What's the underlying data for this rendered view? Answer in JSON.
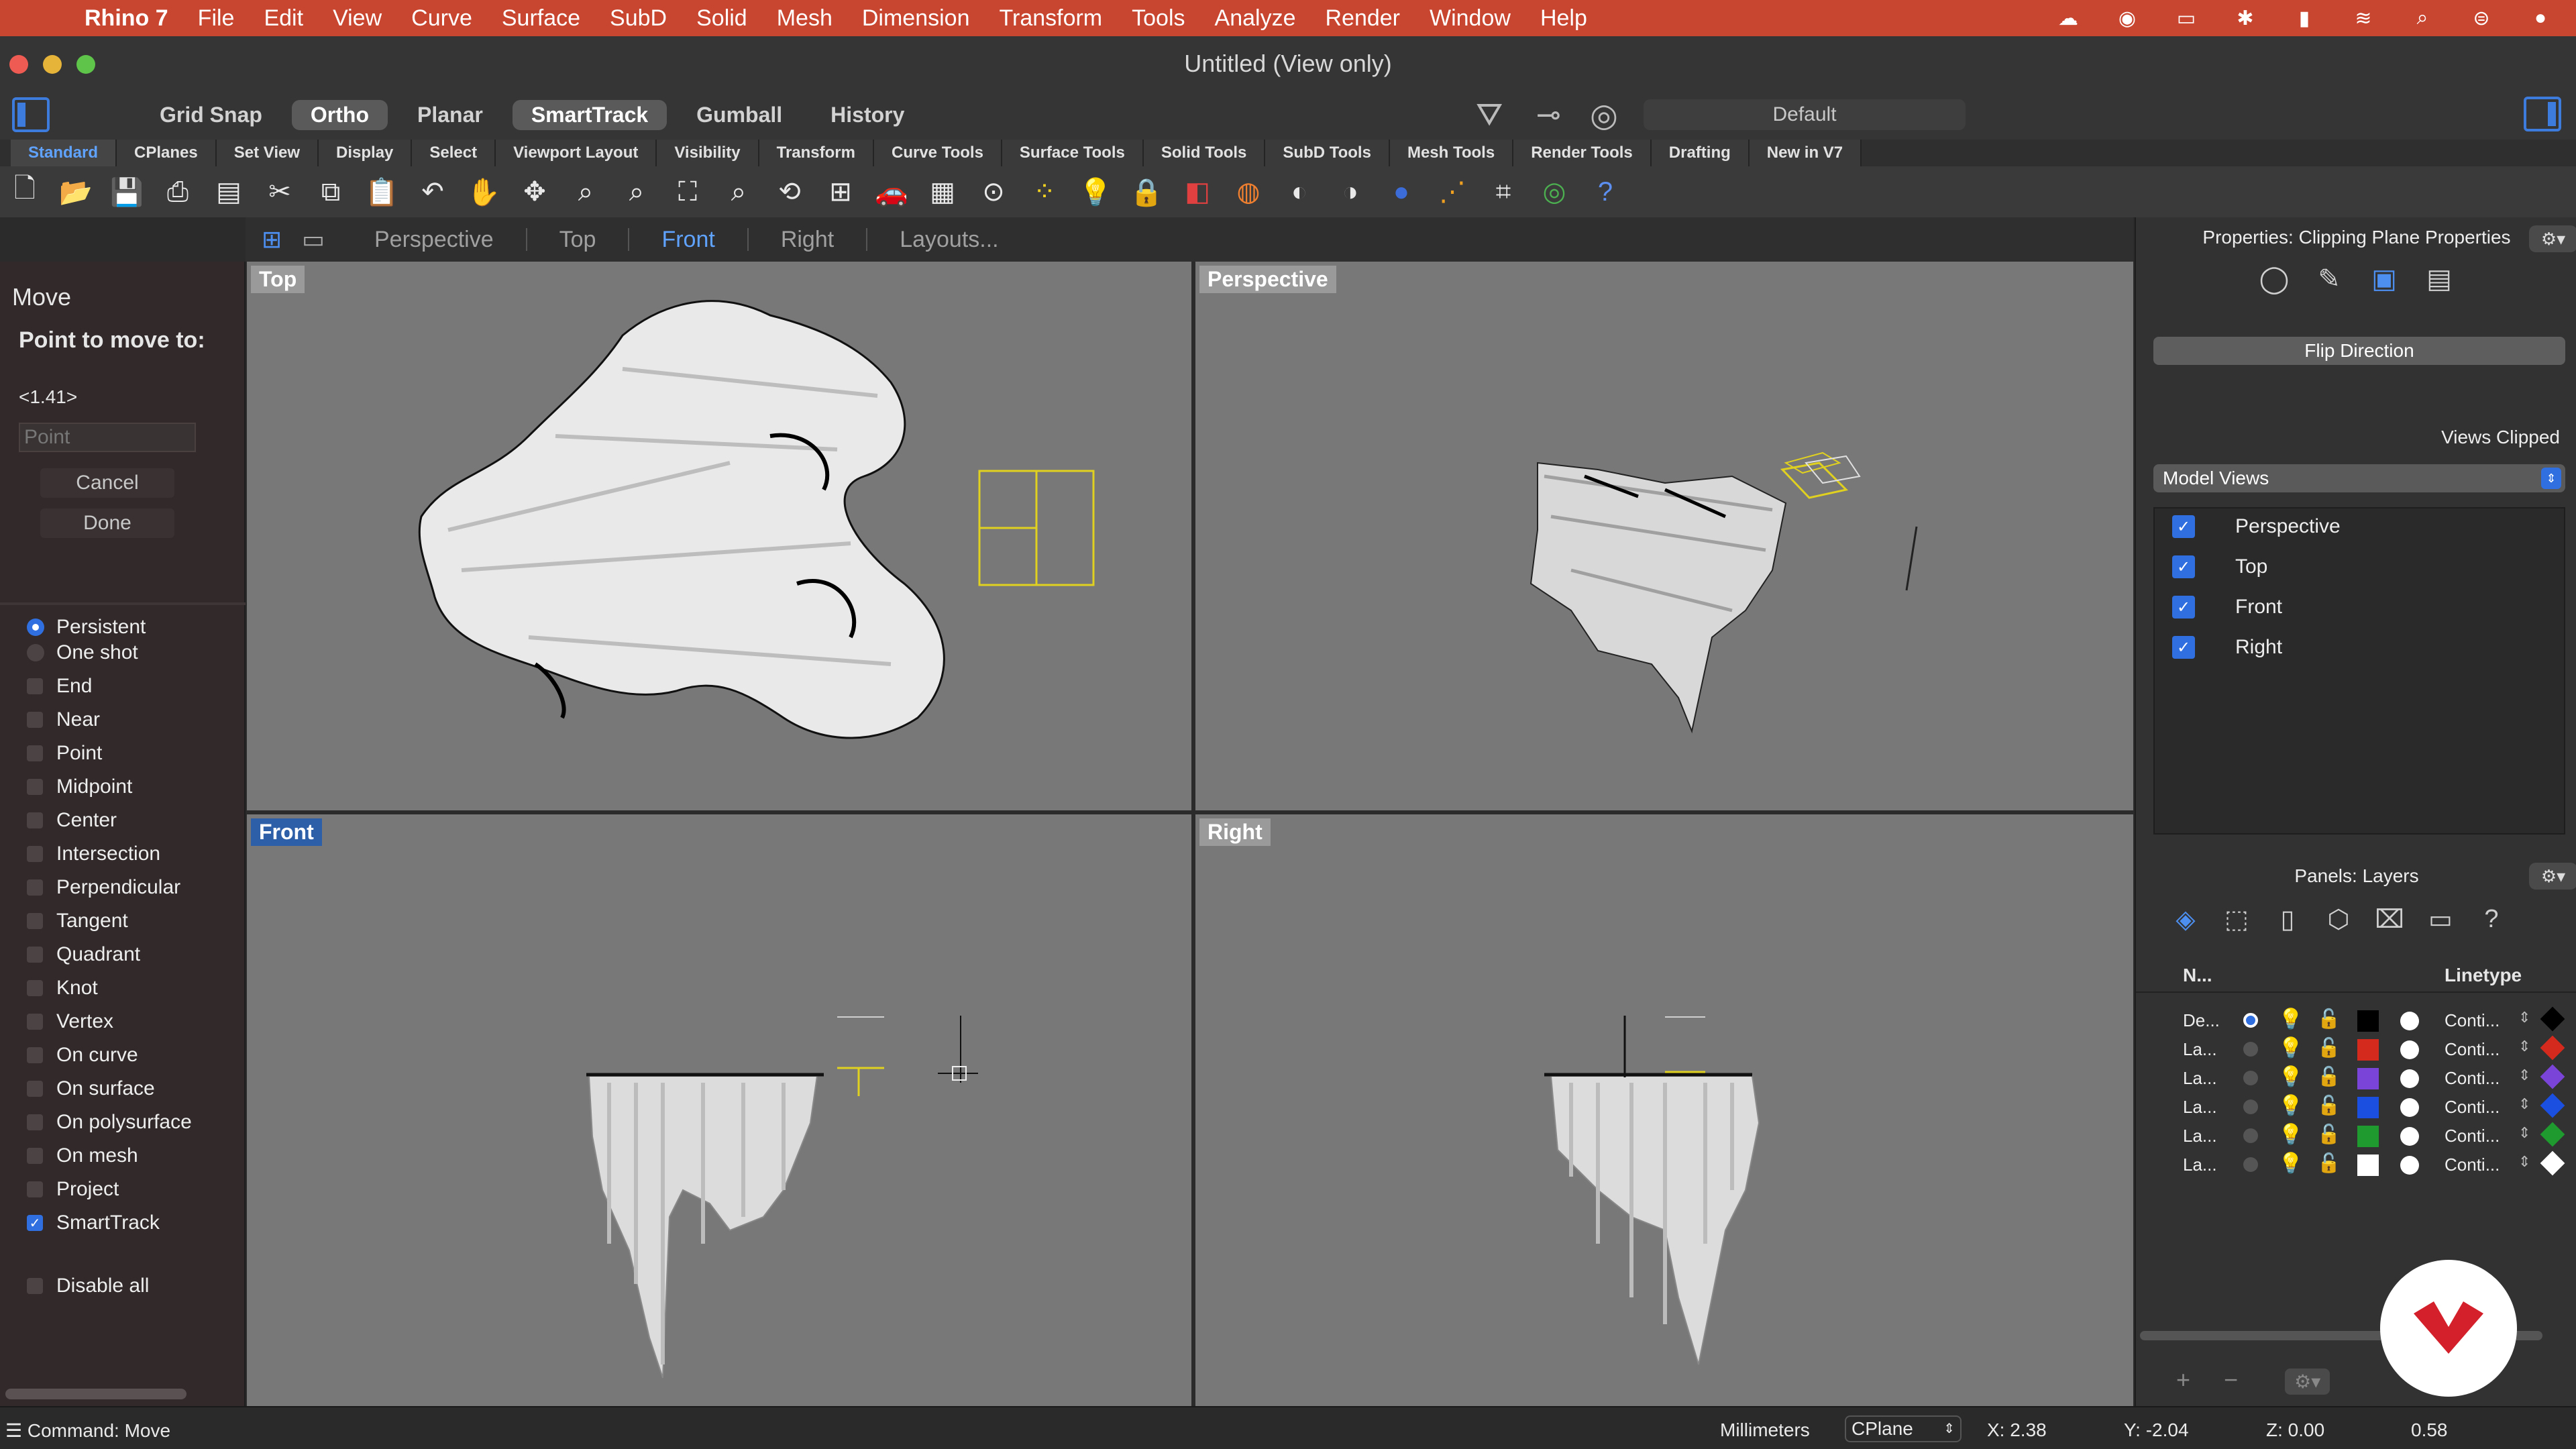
{
  "menubar": {
    "app": "Rhino 7",
    "items": [
      "File",
      "Edit",
      "View",
      "Curve",
      "Surface",
      "SubD",
      "Solid",
      "Mesh",
      "Dimension",
      "Transform",
      "Tools",
      "Analyze",
      "Render",
      "Window",
      "Help"
    ]
  },
  "window": {
    "title": "Untitled (View only)"
  },
  "toggles": {
    "grid_snap": "Grid Snap",
    "ortho": "Ortho",
    "planar": "Planar",
    "smarttrack": "SmartTrack",
    "gumball": "Gumball",
    "history": "History",
    "display_mode": "Default"
  },
  "tabs": [
    "Standard",
    "CPlanes",
    "Set View",
    "Display",
    "Select",
    "Viewport Layout",
    "Visibility",
    "Transform",
    "Curve Tools",
    "Surface Tools",
    "Solid Tools",
    "SubD Tools",
    "Mesh Tools",
    "Render Tools",
    "Drafting",
    "New in V7"
  ],
  "viewport_tabs": {
    "perspective": "Perspective",
    "top": "Top",
    "front": "Front",
    "right": "Right",
    "layouts": "Layouts..."
  },
  "command_panel": {
    "title": "Move",
    "prompt": "Point to move to:",
    "scale": "<1.41>",
    "point_placeholder": "Point",
    "cancel": "Cancel",
    "done": "Done",
    "persistent": "Persistent",
    "one_shot": "One shot",
    "osnaps": [
      "End",
      "Near",
      "Point",
      "Midpoint",
      "Center",
      "Intersection",
      "Perpendicular",
      "Tangent",
      "Quadrant",
      "Knot",
      "Vertex",
      "On curve",
      "On surface",
      "On polysurface",
      "On mesh",
      "Project",
      "SmartTrack"
    ],
    "disable_all": "Disable all"
  },
  "viewports": {
    "top": "Top",
    "perspective": "Perspective",
    "front": "Front",
    "right": "Right"
  },
  "properties": {
    "title": "Properties: Clipping Plane Properties",
    "flip_direction": "Flip Direction",
    "views_clipped": "Views Clipped",
    "model_views": "Model Views",
    "views": [
      "Perspective",
      "Top",
      "Front",
      "Right"
    ]
  },
  "layers": {
    "title": "Panels: Layers",
    "col_name": "N...",
    "col_linetype": "Linetype",
    "rows": [
      {
        "name": "De...",
        "linetype": "Conti...",
        "color": "#000000",
        "current": true
      },
      {
        "name": "La...",
        "linetype": "Conti...",
        "color": "#d42a1e",
        "current": false
      },
      {
        "name": "La...",
        "linetype": "Conti...",
        "color": "#7a44d8",
        "current": false
      },
      {
        "name": "La...",
        "linetype": "Conti...",
        "color": "#1a4fe0",
        "current": false
      },
      {
        "name": "La...",
        "linetype": "Conti...",
        "color": "#1f9a2e",
        "current": false
      },
      {
        "name": "La...",
        "linetype": "Conti...",
        "color": "#ffffff",
        "current": false
      }
    ]
  },
  "statusbar": {
    "command": "Command: Move",
    "units": "Millimeters",
    "cplane": "CPlane",
    "x": "X: 2.38",
    "y": "Y: -2.04",
    "z": "Z: 0.00",
    "value": "0.58"
  },
  "colors": {
    "accent": "#2f6fe0",
    "menubar": "#c8452f",
    "viewport_bg": "#787878",
    "clip_plane": "#e0d020"
  }
}
